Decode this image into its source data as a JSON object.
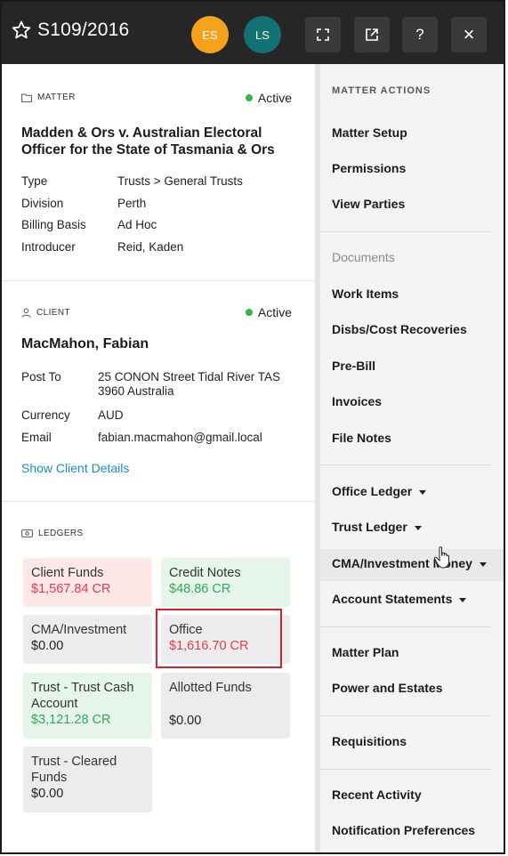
{
  "header": {
    "title": "S109/2016",
    "avatars": [
      {
        "initials": "ES",
        "color": "#f6a21c"
      },
      {
        "initials": "LS",
        "color": "#137073"
      }
    ],
    "buttons": [
      "expand-icon",
      "open-external-icon",
      "help-icon",
      "close-icon"
    ],
    "help_label": "?",
    "close_label": "×"
  },
  "matter": {
    "section_label": "MATTER",
    "status": "Active",
    "name": "Madden & Ors v. Australian Electoral Officer for the State of Tasmania & Ors",
    "fields": [
      {
        "key": "Type",
        "value": "Trusts > General Trusts"
      },
      {
        "key": "Division",
        "value": "Perth"
      },
      {
        "key": "Billing Basis",
        "value": "Ad Hoc"
      },
      {
        "key": "Introducer",
        "value": "Reid, Kaden"
      }
    ]
  },
  "client": {
    "section_label": "CLIENT",
    "status": "Active",
    "name": "MacMahon, Fabian",
    "post_to_label": "Post To",
    "post_to_line1": "25 CONON Street Tidal River TAS",
    "post_to_line2": "3960 Australia",
    "currency_label": "Currency",
    "currency": "AUD",
    "email_label": "Email",
    "email": "fabian.macmahon@gmail.local",
    "details_link": "Show Client Details"
  },
  "ledgers": {
    "section_label": "LEDGERS",
    "cards": [
      {
        "label": "Client Funds",
        "amount": "$1,567.84 CR"
      },
      {
        "label": "Credit Notes",
        "amount": "$48.86 CR"
      },
      {
        "label": "CMA/Investment",
        "amount": "$0.00"
      },
      {
        "label": "Office",
        "amount": "$1,616.70 CR"
      },
      {
        "label_line1": "Trust - Trust Cash",
        "label_line2": "Account",
        "amount": "$3,121.28 CR"
      },
      {
        "label": "Allotted Funds",
        "amount": "$0.00"
      },
      {
        "label_line1": "Trust - Cleared",
        "label_line2": "Funds",
        "amount": "$0.00"
      }
    ]
  },
  "actions": {
    "heading": "MATTER ACTIONS",
    "items": [
      "Matter Setup",
      "Permissions",
      "View Parties",
      "Documents",
      "Work Items",
      "Disbs/Cost Recoveries",
      "Pre-Bill",
      "Invoices",
      "File Notes",
      "Office Ledger",
      "Trust Ledger",
      "CMA/Investment Money",
      "Account Statements",
      "Matter Plan",
      "Power and Estates",
      "Requisitions",
      "Recent Activity",
      "Notification Preferences"
    ]
  },
  "colors": {
    "header_bg": "#262626",
    "active": "#33b54a",
    "credit_red": "#e03c4f",
    "credit_green": "#36a853",
    "link": "#1a8fbf",
    "highlight": "#d8222b"
  }
}
